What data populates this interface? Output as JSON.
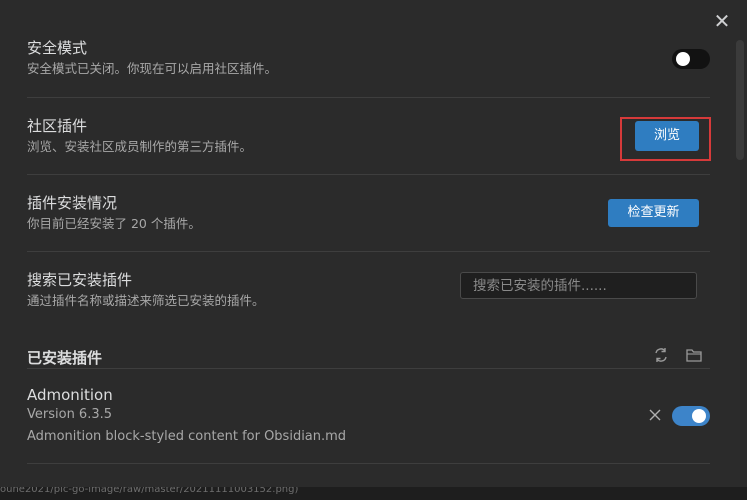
{
  "modal": {
    "close_icon": "✕"
  },
  "settings": [
    {
      "name": "安全模式",
      "desc": "安全模式已关闭。你现在可以启用社区插件。",
      "toggle": "off"
    },
    {
      "name": "社区插件",
      "desc": "浏览、安装社区成员制作的第三方插件。",
      "button": "浏览"
    },
    {
      "name": "插件安装情况",
      "desc": "你目前已经安装了 20 个插件。",
      "button": "检查更新"
    },
    {
      "name": "搜索已安装插件",
      "desc": "通过插件名称或描述来筛选已安装的插件。"
    }
  ],
  "search": {
    "placeholder": "搜索已安装的插件......"
  },
  "installed": {
    "heading": "已安装插件",
    "plugins": [
      {
        "name": "Admonition",
        "version": "Version 6.3.5",
        "desc": "Admonition block-styled content for Obsidian.md",
        "enabled": true
      }
    ]
  },
  "background_text": "ouhe2021/pic-go-image/raw/master/20211111003152.png)",
  "colors": {
    "accent": "#2f7dc1",
    "toggle_on": "#3d84c9",
    "highlight": "#d63a3a",
    "modal_bg": "#2b2b2b"
  }
}
